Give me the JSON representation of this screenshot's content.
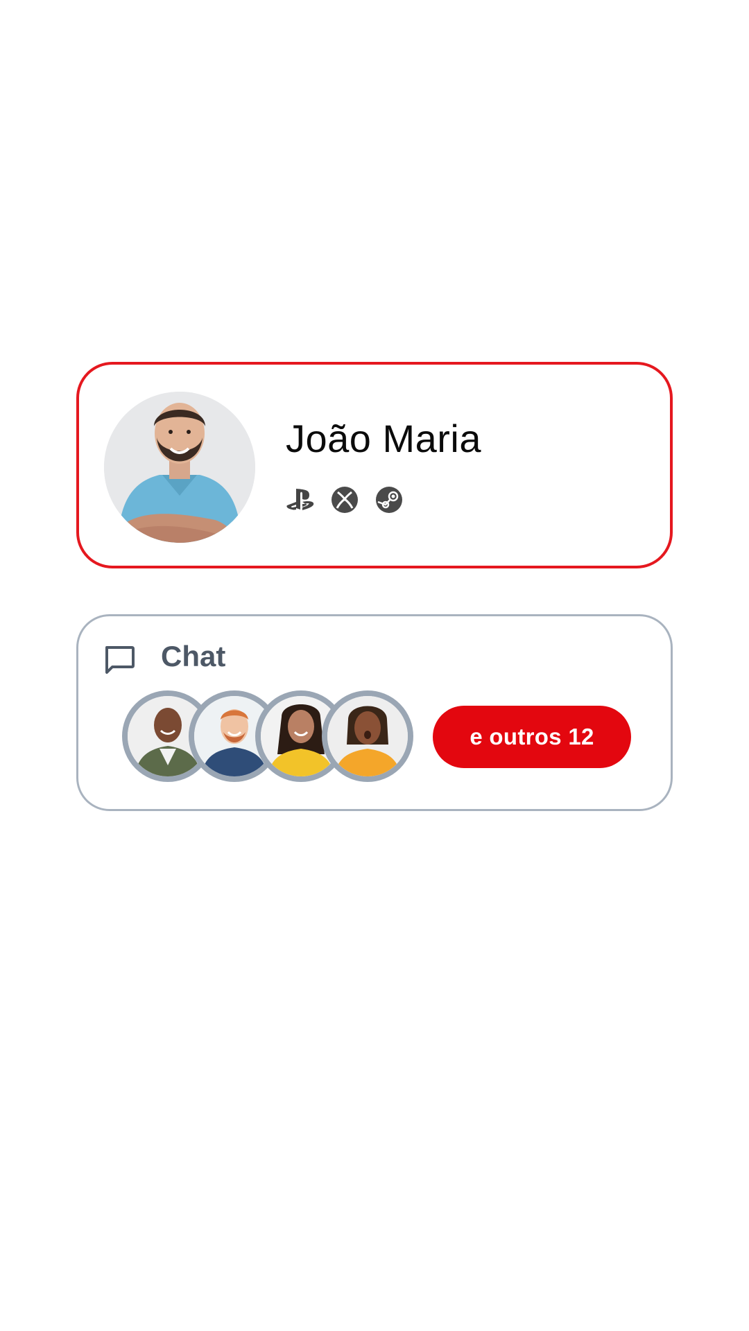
{
  "profile": {
    "name": "João Maria",
    "platforms": [
      {
        "icon": "playstation-icon"
      },
      {
        "icon": "xbox-icon"
      },
      {
        "icon": "steam-icon"
      }
    ],
    "accent_color": "#e5181f"
  },
  "chat": {
    "title": "Chat",
    "icon": "chat-bubble-icon",
    "participants": [
      {
        "avatar": "participant-avatar-1"
      },
      {
        "avatar": "participant-avatar-2"
      },
      {
        "avatar": "participant-avatar-3"
      },
      {
        "avatar": "participant-avatar-4"
      }
    ],
    "more_label": "e outros 12",
    "button_color": "#e3070f",
    "border_color": "#a9b3bf"
  }
}
